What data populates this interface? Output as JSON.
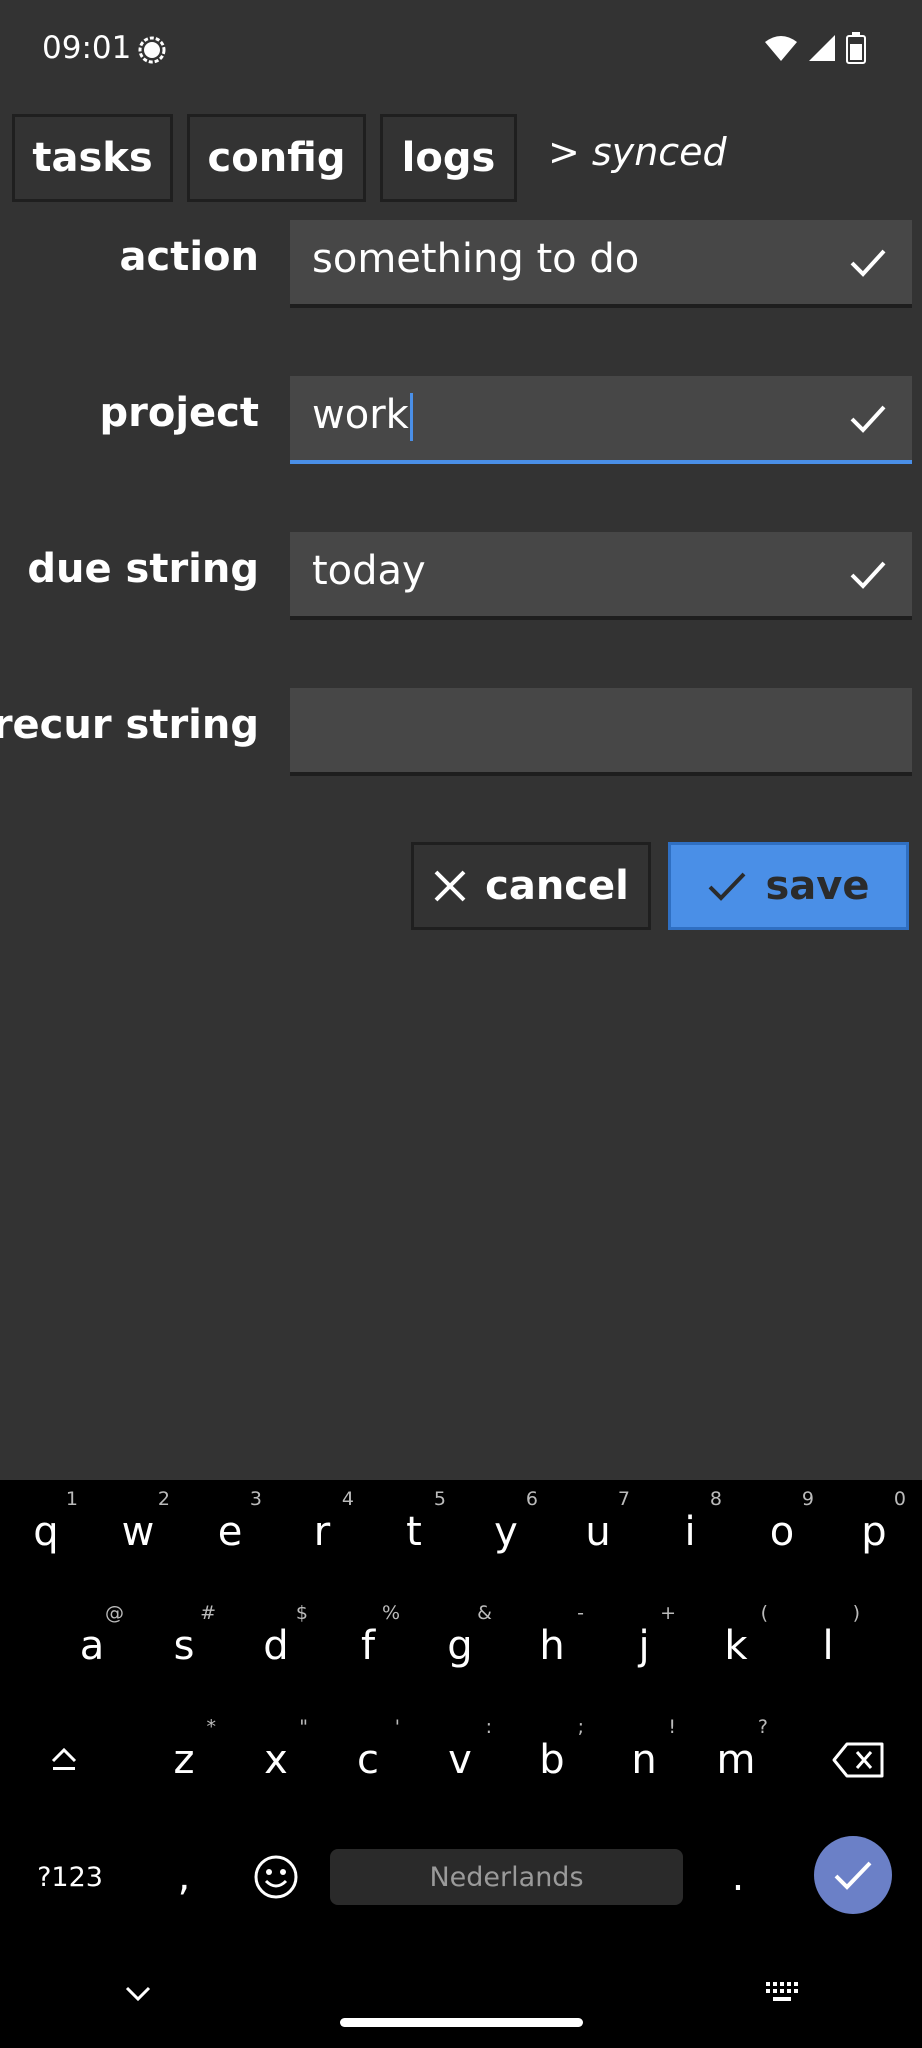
{
  "status_bar": {
    "time": "09:01",
    "icons": [
      "signal-app-icon",
      "wifi-icon",
      "cell-signal-icon",
      "battery-icon"
    ]
  },
  "tabs": [
    {
      "label": "tasks"
    },
    {
      "label": "config"
    },
    {
      "label": "logs"
    }
  ],
  "sync_status": "> synced",
  "form": {
    "fields": [
      {
        "label": "action",
        "value": "something to do",
        "valid": true
      },
      {
        "label": "project",
        "value": "work",
        "valid": true,
        "focused": true
      },
      {
        "label": "due string",
        "value": "today",
        "valid": true
      },
      {
        "label": "recur string",
        "value": "",
        "valid": false
      }
    ],
    "cancel_label": "cancel",
    "save_label": "save"
  },
  "keyboard": {
    "row1": [
      {
        "key": "q",
        "hint": "1"
      },
      {
        "key": "w",
        "hint": "2"
      },
      {
        "key": "e",
        "hint": "3"
      },
      {
        "key": "r",
        "hint": "4"
      },
      {
        "key": "t",
        "hint": "5"
      },
      {
        "key": "y",
        "hint": "6"
      },
      {
        "key": "u",
        "hint": "7"
      },
      {
        "key": "i",
        "hint": "8"
      },
      {
        "key": "o",
        "hint": "9"
      },
      {
        "key": "p",
        "hint": "0"
      }
    ],
    "row2": [
      {
        "key": "a",
        "hint": "@"
      },
      {
        "key": "s",
        "hint": "#"
      },
      {
        "key": "d",
        "hint": "$"
      },
      {
        "key": "f",
        "hint": "%"
      },
      {
        "key": "g",
        "hint": "&"
      },
      {
        "key": "h",
        "hint": "-"
      },
      {
        "key": "j",
        "hint": "+"
      },
      {
        "key": "k",
        "hint": "("
      },
      {
        "key": "l",
        "hint": ")"
      }
    ],
    "row3": [
      {
        "key": "z",
        "hint": "*"
      },
      {
        "key": "x",
        "hint": "\""
      },
      {
        "key": "c",
        "hint": "'"
      },
      {
        "key": "v",
        "hint": ":"
      },
      {
        "key": "b",
        "hint": ";"
      },
      {
        "key": "n",
        "hint": "!"
      },
      {
        "key": "m",
        "hint": "?"
      }
    ],
    "symbols_label": "?123",
    "comma_label": ",",
    "period_label": ".",
    "space_label": "Nederlands"
  },
  "colors": {
    "background": "#333333",
    "field": "#474747",
    "accent": "#4a8fe7",
    "keyboard": "#000000",
    "enter_key": "#6b80c7"
  }
}
